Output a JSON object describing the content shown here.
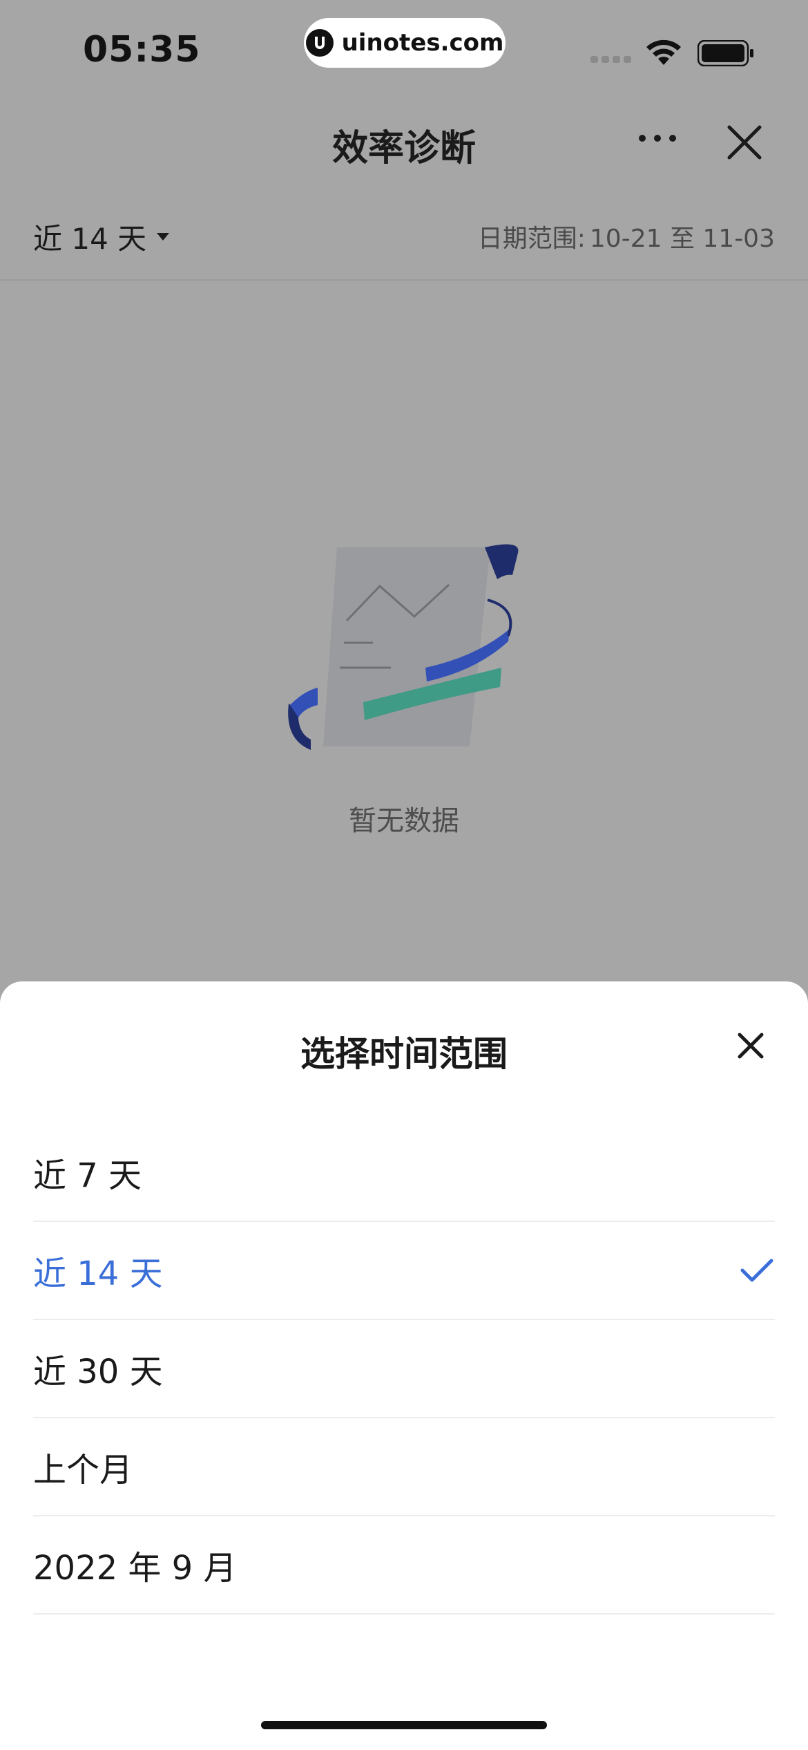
{
  "status_bar": {
    "time": "05:35",
    "watermark": "uinotes.com"
  },
  "nav": {
    "title": "效率诊断",
    "more_icon": "ellipsis-icon",
    "close_icon": "close-icon"
  },
  "filter": {
    "period_label": "近 14 天",
    "range_label": "日期范围:",
    "range_value": "10-21 至 11-03"
  },
  "empty_state": {
    "text": "暂无数据"
  },
  "sheet": {
    "title": "选择时间范围",
    "options": [
      {
        "label": "近 7 天",
        "selected": false
      },
      {
        "label": "近 14 天",
        "selected": true
      },
      {
        "label": "近 30 天",
        "selected": false
      },
      {
        "label": "上个月",
        "selected": false
      },
      {
        "label": "2022 年 9 月",
        "selected": false
      }
    ]
  },
  "colors": {
    "accent": "#3b6fd8",
    "overlay": "#a6a6a6",
    "sheet": "#ffffff"
  }
}
